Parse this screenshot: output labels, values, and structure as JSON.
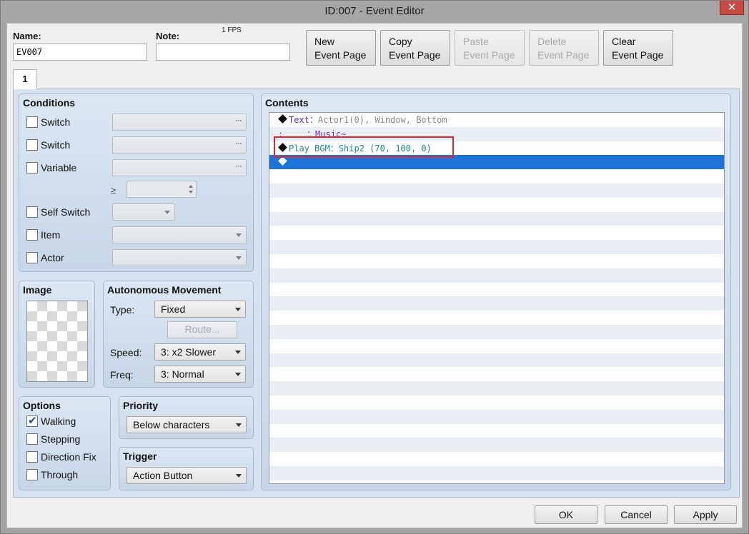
{
  "window": {
    "title": "ID:007 - Event Editor",
    "close_glyph": "✕"
  },
  "fps": "1 FPS",
  "name": {
    "label": "Name:",
    "value": "EV007"
  },
  "note": {
    "label": "Note:",
    "value": ""
  },
  "toolbar": {
    "new_page": [
      "New",
      "Event Page"
    ],
    "copy_page": [
      "Copy",
      "Event Page"
    ],
    "paste_page": [
      "Paste",
      "Event Page"
    ],
    "delete_page": [
      "Delete",
      "Event Page"
    ],
    "clear_page": [
      "Clear",
      "Event Page"
    ]
  },
  "tabs": [
    {
      "label": "1",
      "active": true
    }
  ],
  "conditions": {
    "title": "Conditions",
    "rows": [
      {
        "label": "Switch",
        "checked": false,
        "control": "browse",
        "value": ""
      },
      {
        "label": "Switch",
        "checked": false,
        "control": "browse",
        "value": ""
      },
      {
        "label": "Variable",
        "checked": false,
        "control": "browse",
        "value": ""
      },
      {
        "label": "Self Switch",
        "checked": false,
        "control": "combo",
        "value": ""
      },
      {
        "label": "Item",
        "checked": false,
        "control": "combo",
        "value": ""
      },
      {
        "label": "Actor",
        "checked": false,
        "control": "combo",
        "value": ""
      }
    ],
    "ge_symbol": "≥",
    "variable_value": ""
  },
  "image": {
    "title": "Image"
  },
  "autonomous": {
    "title": "Autonomous Movement",
    "type_label": "Type:",
    "type_value": "Fixed",
    "route_label": "Route...",
    "speed_label": "Speed:",
    "speed_value": "3: x2 Slower",
    "freq_label": "Freq:",
    "freq_value": "3: Normal"
  },
  "options": {
    "title": "Options",
    "items": [
      {
        "label": "Walking",
        "checked": true
      },
      {
        "label": "Stepping",
        "checked": false
      },
      {
        "label": "Direction Fix",
        "checked": false
      },
      {
        "label": "Through",
        "checked": false
      }
    ]
  },
  "priority": {
    "title": "Priority",
    "value": "Below characters"
  },
  "trigger": {
    "title": "Trigger",
    "value": "Action Button"
  },
  "contents": {
    "title": "Contents",
    "commands": [
      {
        "name": "Text",
        "sep": "：",
        "args": "Actor1(0), Window, Bottom",
        "kind": "text",
        "marker": true
      },
      {
        "name": "",
        "sep": "：",
        "args": "Music~",
        "kind": "cont",
        "marker": false,
        "prefix": ":"
      },
      {
        "name": "Play BGM",
        "sep": "：",
        "args": "Ship2 (70, 100, 0)",
        "kind": "bgm",
        "marker": true
      },
      {
        "name": "",
        "sep": "",
        "args": "",
        "kind": "end",
        "marker": true,
        "selected": true
      }
    ]
  },
  "dialog": {
    "ok": "OK",
    "cancel": "Cancel",
    "apply": "Apply"
  },
  "colors": {
    "selection": "#1e74d6",
    "highlight_box": "#e0262b",
    "close": "#c74a43"
  }
}
